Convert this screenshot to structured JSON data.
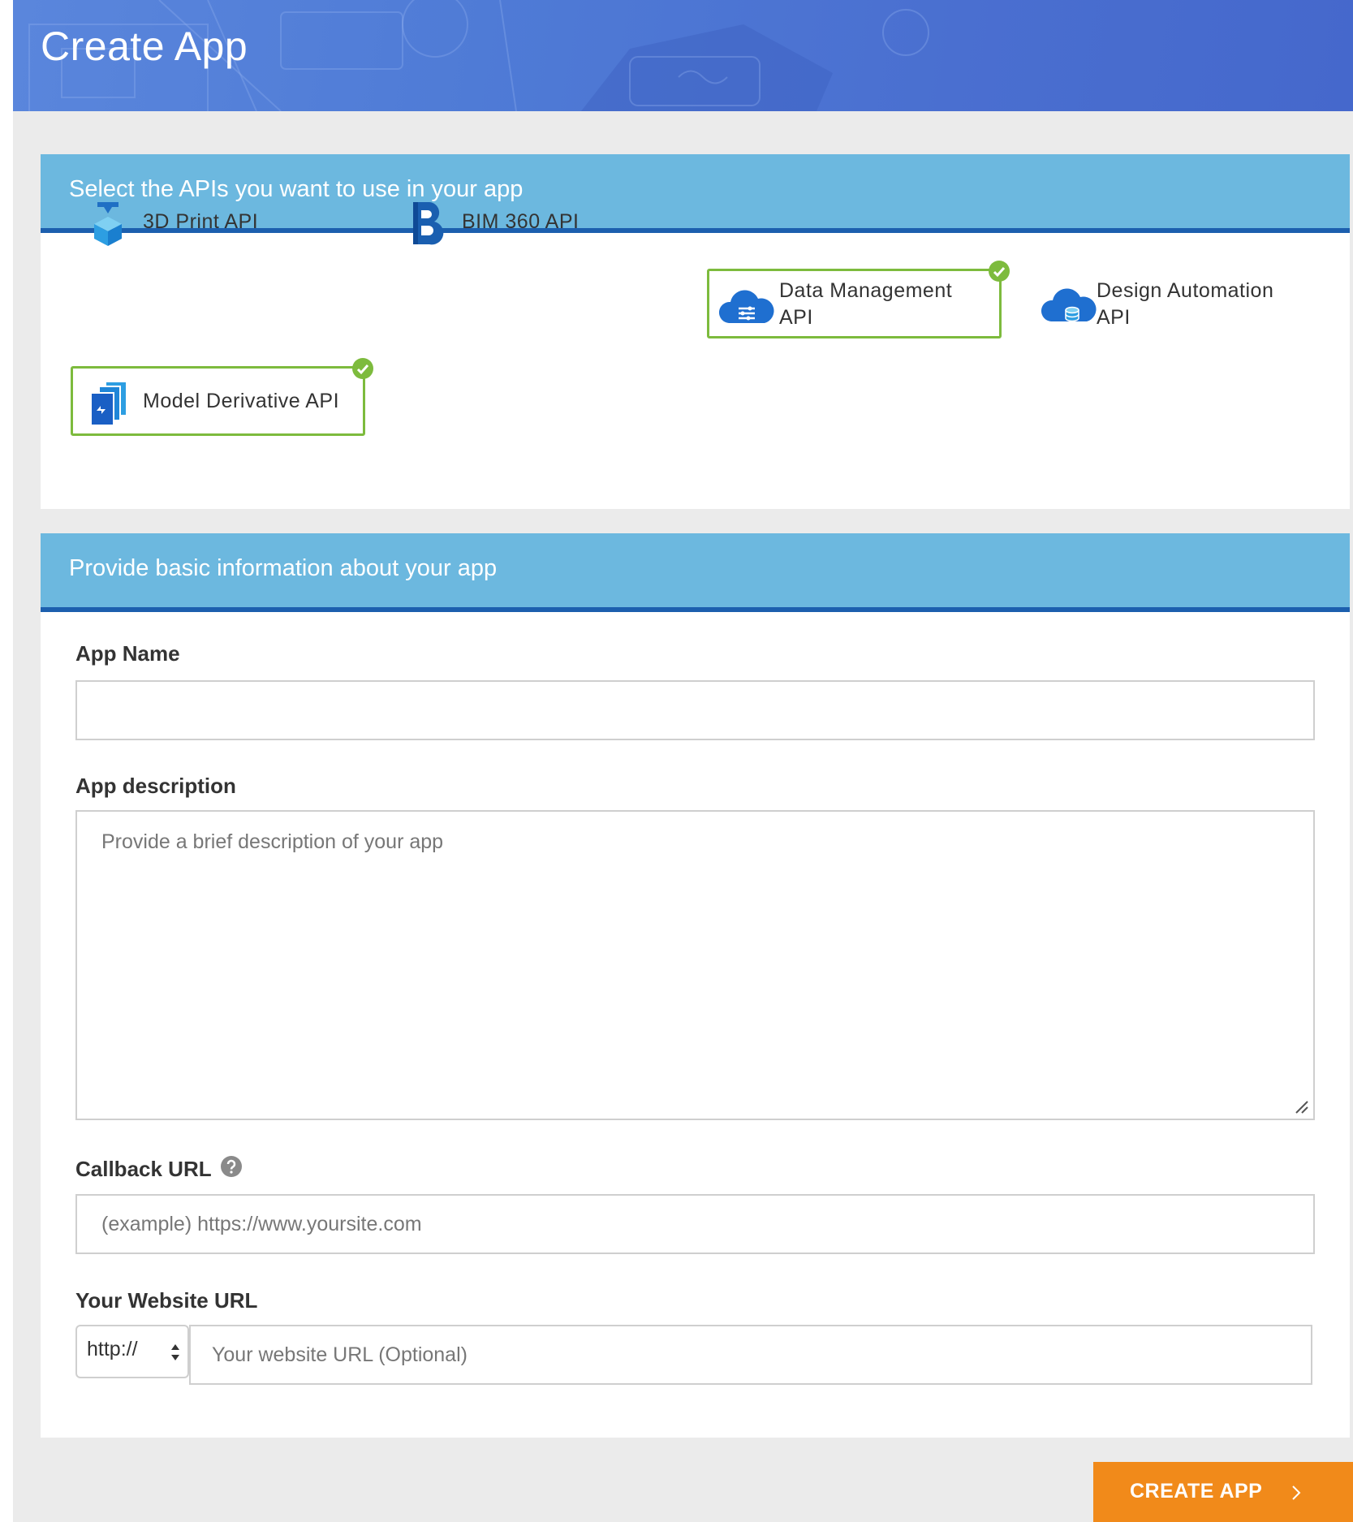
{
  "header": {
    "title": "Create App"
  },
  "api_section": {
    "heading": "Select the APIs you want to use in your app",
    "apis": [
      {
        "label_line1": "3D Print API",
        "label_line2": "",
        "icon": "3d-print-icon",
        "selected": false
      },
      {
        "label_line1": "BIM 360 API",
        "label_line2": "",
        "icon": "bim360-icon",
        "selected": false
      },
      {
        "label_line1": "Data Management",
        "label_line2": "API",
        "icon": "data-management-cloud-icon",
        "selected": true
      },
      {
        "label_line1": "Design Automation",
        "label_line2": "API",
        "icon": "design-automation-cloud-icon",
        "selected": false
      },
      {
        "label_line1": "Model Derivative API",
        "label_line2": "",
        "icon": "model-derivative-icon",
        "selected": true
      }
    ]
  },
  "info_section": {
    "heading": "Provide basic information about your app",
    "app_name": {
      "label": "App Name",
      "value": "",
      "placeholder": ""
    },
    "app_description": {
      "label": "App description",
      "value": "",
      "placeholder": "Provide a brief description of your app"
    },
    "callback_url": {
      "label": "Callback URL",
      "help_icon": "help-icon",
      "value": "",
      "placeholder": "(example) https://www.yoursite.com"
    },
    "website_url": {
      "label": "Your Website URL",
      "protocol": "http://",
      "value": "",
      "placeholder": "Your website URL (Optional)"
    }
  },
  "actions": {
    "create_label": "CREATE APP"
  },
  "colors": {
    "banner": "#4f7bd6",
    "section_header": "#6cb8df",
    "section_border": "#1c5fae",
    "selected_border": "#7dbb3d",
    "primary_button": "#f18a1a"
  }
}
